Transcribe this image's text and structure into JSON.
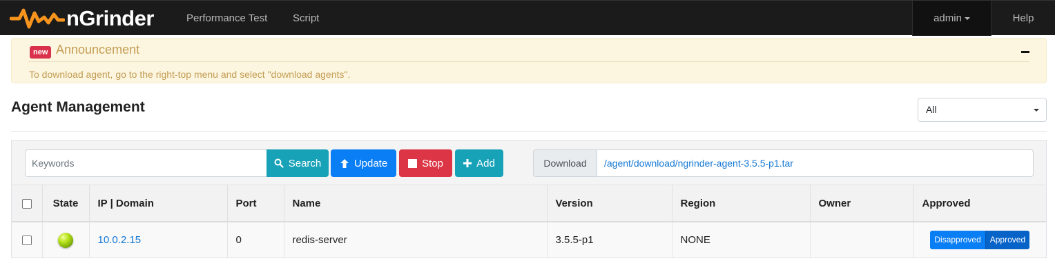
{
  "navbar": {
    "logo_text": "nGrinder",
    "links": [
      "Performance Test",
      "Script"
    ],
    "user": "admin",
    "help": "Help",
    "brand_color": "#f7941d"
  },
  "announcement": {
    "badge": "new",
    "title": "Announcement",
    "text": "To download agent, go to the right-top menu and select \"download agents\"."
  },
  "page": {
    "title": "Agent Management",
    "filter_value": "All"
  },
  "toolbar": {
    "search_placeholder": "Keywords",
    "search_label": "Search",
    "update_label": "Update",
    "stop_label": "Stop",
    "add_label": "Add",
    "download_label": "Download",
    "download_path": "/agent/download/ngrinder-agent-3.5.5-p1.tar"
  },
  "table": {
    "headers": [
      "State",
      "IP | Domain",
      "Port",
      "Name",
      "Version",
      "Region",
      "Owner",
      "Approved"
    ],
    "rows": [
      {
        "state": "running",
        "ip": "10.0.2.15",
        "port": "0",
        "name": "redis-server",
        "version": "3.5.5-p1",
        "region": "NONE",
        "owner": "",
        "disapproved_label": "Disapproved",
        "approved_label": "Approved"
      }
    ]
  }
}
